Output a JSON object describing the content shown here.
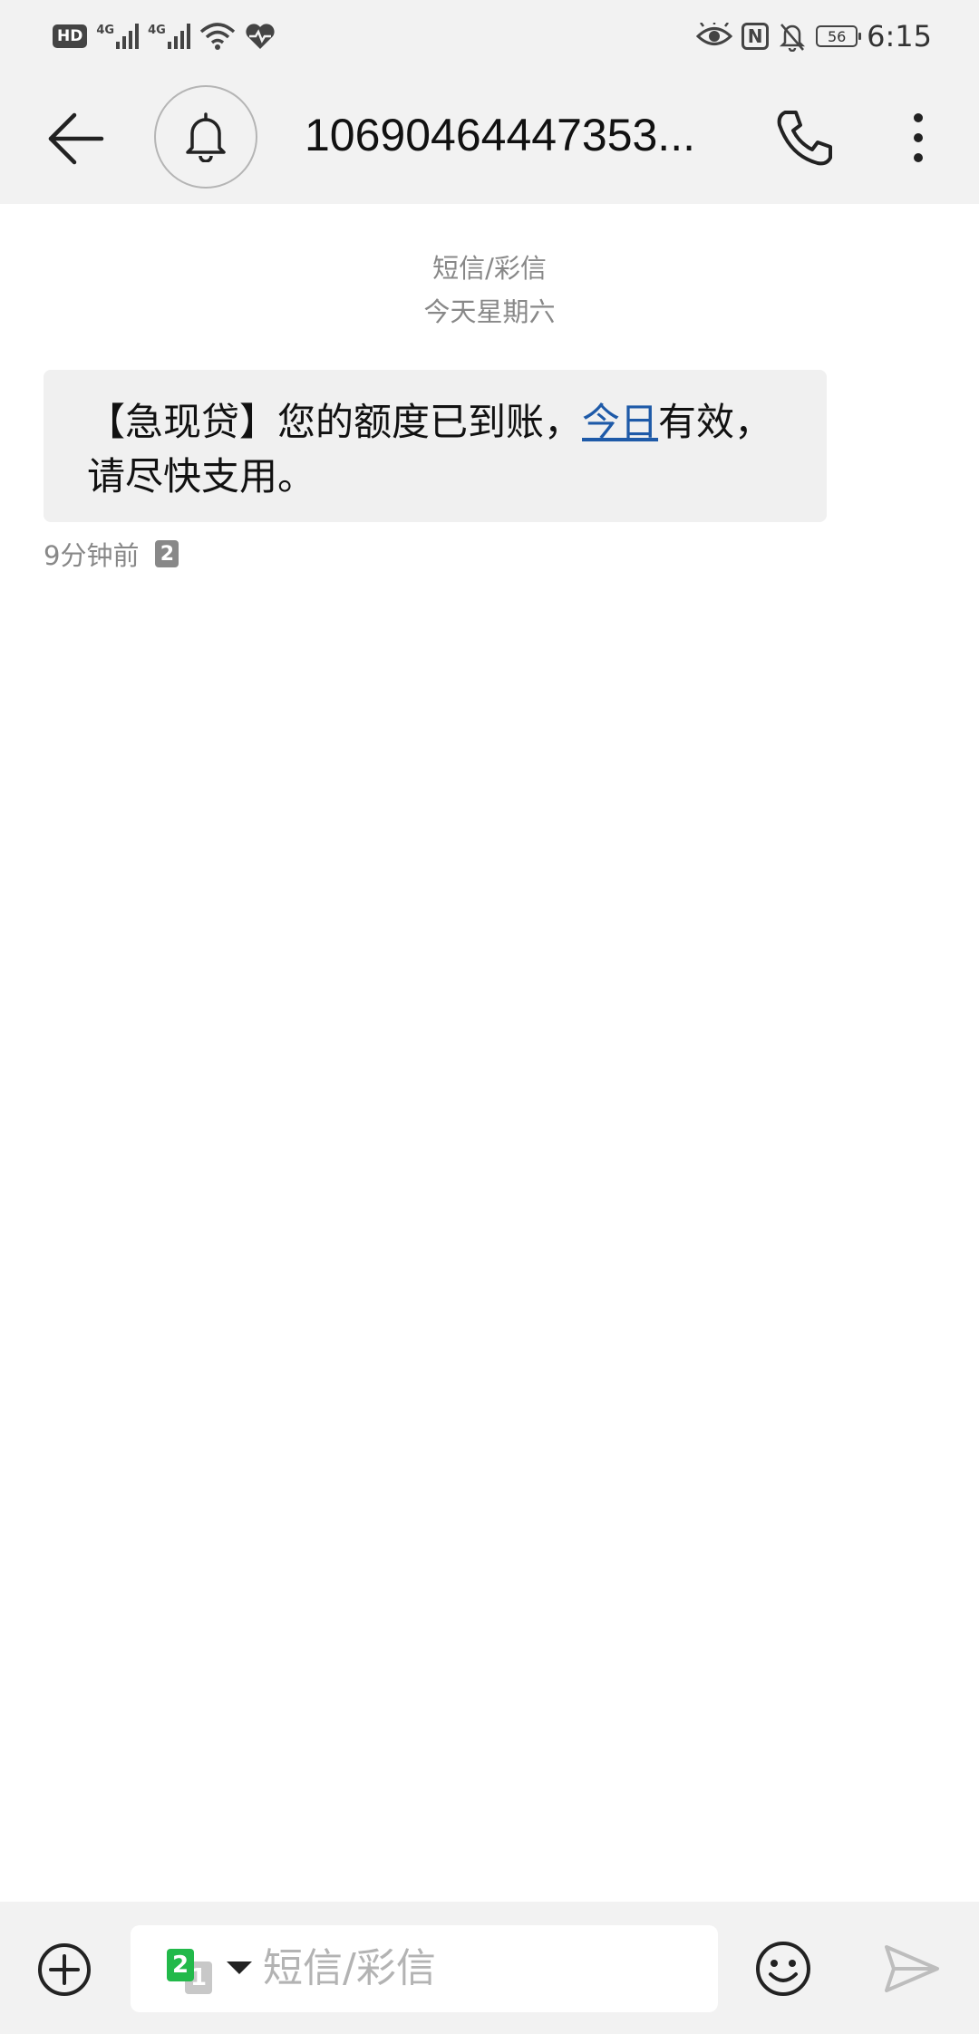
{
  "status_bar": {
    "hd": "HD",
    "network1": "4G",
    "network2": "4G",
    "battery": "56",
    "time": "6:15",
    "nfc": "N",
    "icons": [
      "eye-comfort-icon",
      "nfc-icon",
      "bell-off-icon",
      "wifi-icon",
      "heart-rate-icon"
    ]
  },
  "header": {
    "contact": "10690464447353..."
  },
  "conversation": {
    "channel": "短信/彩信",
    "date": "今天星期六",
    "message": {
      "part1": "【急现贷】您的额度已到账，",
      "link": "今日",
      "part2": "有效，请尽快支用。"
    },
    "time_ago": "9分钟前",
    "sim": "2"
  },
  "composer": {
    "placeholder": "短信/彩信",
    "sim_active": "2",
    "sim_inactive": "1"
  },
  "colors": {
    "accent_link": "#1e5aa8",
    "sim2_green": "#22b94a",
    "bar_bg": "#f2f2f2"
  }
}
